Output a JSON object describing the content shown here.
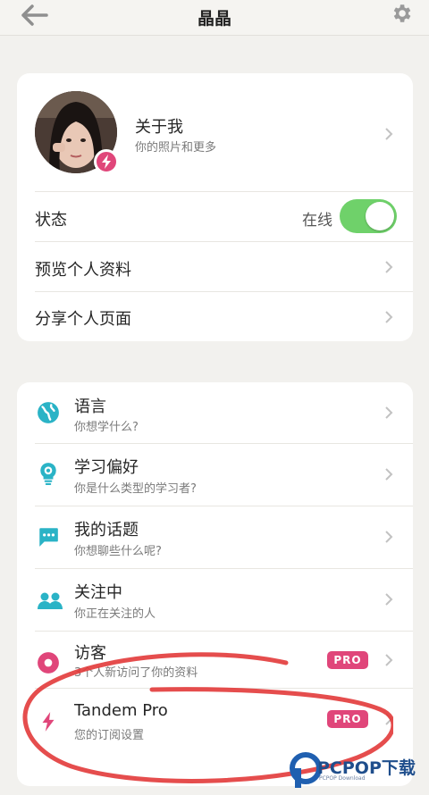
{
  "header": {
    "title": "晶晶"
  },
  "profile_card": {
    "about": {
      "title": "关于我",
      "subtitle": "你的照片和更多"
    },
    "status": {
      "label": "状态",
      "value": "在线",
      "enabled": true
    },
    "preview_profile": {
      "label": "预览个人资料"
    },
    "share_profile": {
      "label": "分享个人页面"
    }
  },
  "settings_list": [
    {
      "title": "语言",
      "subtitle": "你想学什么?",
      "icon": "globe-icon"
    },
    {
      "title": "学习偏好",
      "subtitle": "你是什么类型的学习者?",
      "icon": "lightbulb-gear-icon"
    },
    {
      "title": "我的话题",
      "subtitle": "你想聊些什么呢?",
      "icon": "chat-bubble-icon"
    },
    {
      "title": "关注中",
      "subtitle": "你正在关注的人",
      "icon": "people-icon"
    },
    {
      "title": "访客",
      "subtitle": "3个人新访问了你的资料",
      "icon": "visitor-icon",
      "badge": "PRO"
    },
    {
      "title": "Tandem Pro",
      "subtitle": "您的订阅设置",
      "icon": "bolt-icon",
      "badge": "PRO"
    }
  ],
  "watermark": {
    "text": "PCPOP下载",
    "sub": "PCPOP Download"
  },
  "colors": {
    "accent": "#e0467a",
    "toggle_on": "#6fd16a",
    "icon_teal": "#2ab3c6",
    "annotation_red": "#e23a3a"
  }
}
